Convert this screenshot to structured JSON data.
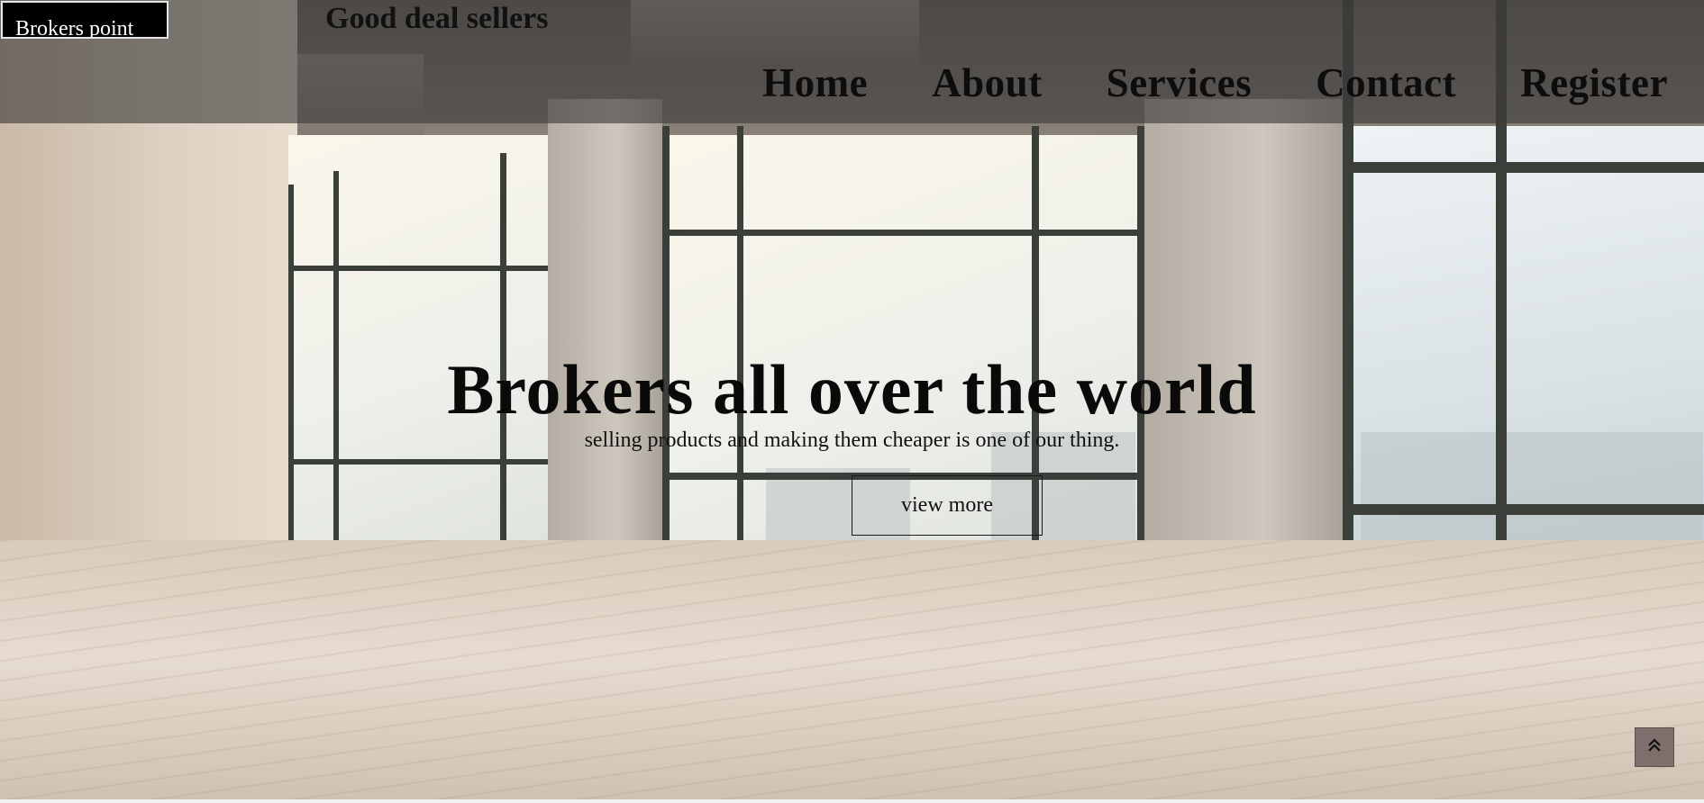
{
  "header": {
    "brand": "Brokers point",
    "tagline": "Good deal sellers",
    "nav": [
      "Home",
      "About",
      "Services",
      "Contact",
      "Register"
    ]
  },
  "hero": {
    "title": "Brokers all over the world",
    "subtitle": "selling products and making them cheaper is one of our thing.",
    "button_label": "view more"
  },
  "icons": {
    "scroll_top": "double-chevron-up-icon"
  },
  "colors": {
    "header_overlay": "#3c3a3a",
    "brand_bg": "#000000",
    "text": "#0a0a0a",
    "scroll_top_bg": "#7d6f6b"
  }
}
